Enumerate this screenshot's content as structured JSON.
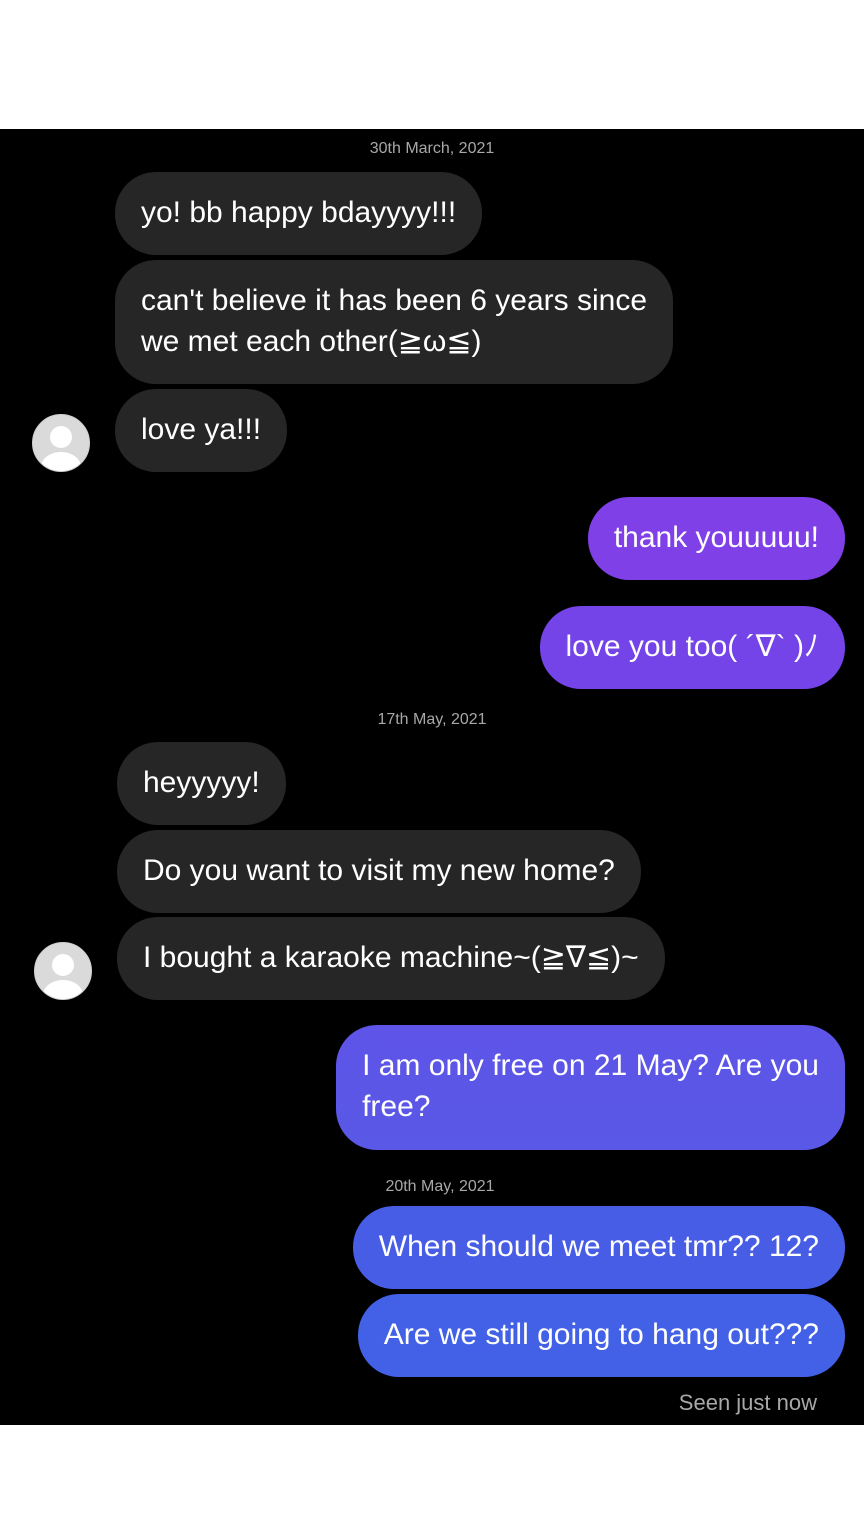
{
  "conversation": {
    "groups": [
      {
        "date": "30th March, 2021",
        "incoming": [
          "yo! bb happy bdayyyy!!!",
          [
            "can't believe it has been 6 years since",
            "we met each other(≧ω≦)"
          ],
          "love ya!!!"
        ],
        "outgoing": [
          "thank youuuuu!",
          "love you too( ´∇` )ﾉ"
        ]
      },
      {
        "date": "17th May, 2021",
        "incoming": [
          "heyyyyy!",
          "Do you want to visit my new home?",
          "I bought a karaoke machine~(≧∇≦)~"
        ],
        "outgoing": [
          [
            "I am only free on 21 May? Are you",
            "free?"
          ]
        ]
      },
      {
        "date": "20th May, 2021",
        "incoming": [],
        "outgoing": [
          "When should we meet tmr?? 12?",
          "Are we still going to hang out???"
        ]
      }
    ],
    "status": "Seen just now"
  },
  "colors": {
    "background": "#000000",
    "incoming_bubble": "#262626",
    "outgoing_gradient_top": "#8a3ee8",
    "outgoing_gradient_bottom": "#3f63e6",
    "muted_text": "#a8a8a8"
  },
  "icons": {
    "avatar": "default-avatar-icon"
  }
}
